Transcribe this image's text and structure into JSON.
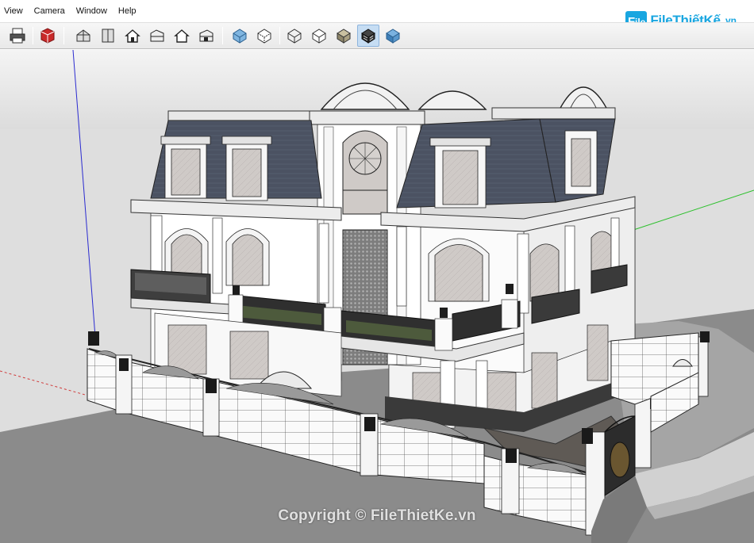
{
  "menu": {
    "items": [
      {
        "label": "View"
      },
      {
        "label": "Camera"
      },
      {
        "label": "Window"
      },
      {
        "label": "Help"
      }
    ]
  },
  "toolbar": {
    "buttons": [
      {
        "icon": "print-icon"
      },
      {
        "icon": "extension-warehouse-icon"
      },
      {
        "icon": "iso-view-icon"
      },
      {
        "icon": "top-view-icon"
      },
      {
        "icon": "front-view-icon"
      },
      {
        "icon": "right-view-icon"
      },
      {
        "icon": "back-view-icon"
      },
      {
        "icon": "left-view-icon"
      },
      {
        "icon": "xray-style-icon"
      },
      {
        "icon": "back-edges-style-icon"
      },
      {
        "icon": "wireframe-style-icon"
      },
      {
        "icon": "hidden-line-style-icon"
      },
      {
        "icon": "shaded-style-icon"
      },
      {
        "icon": "shaded-with-textures-style-icon",
        "active": true
      },
      {
        "icon": "monochrome-style-icon"
      }
    ]
  },
  "logo": {
    "brand": "FileThiếtKế",
    "tld": ".vn"
  },
  "watermark": {
    "text": "Copyright © FileThietKe.vn"
  },
  "colors": {
    "sky": "#e2e2e2",
    "ground": "#8d8d8d",
    "road": "#a6a6a6",
    "sidewalk": "#cfcfcf",
    "roof": "#4a5160",
    "wall": "#ffffff",
    "window": "#d3d0cd",
    "logo": "#19a6e0",
    "axis_blue": "#2b2bd0",
    "axis_green": "#2bc02b",
    "axis_red": "#d03b3b"
  }
}
